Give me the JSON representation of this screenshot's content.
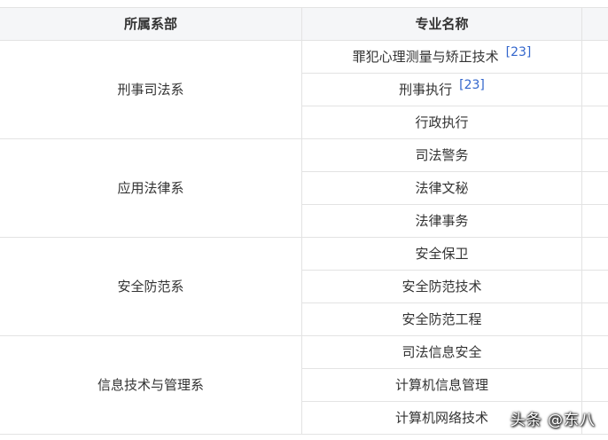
{
  "table": {
    "headers": {
      "department": "所属系部",
      "major": "专业名称",
      "extra": ""
    },
    "groups": [
      {
        "department": "刑事司法系",
        "majors": [
          {
            "name": "罪犯心理测量与矫正技术",
            "cite": "[23]"
          },
          {
            "name": "刑事执行",
            "cite": "[23]"
          },
          {
            "name": "行政执行",
            "cite": ""
          }
        ]
      },
      {
        "department": "应用法律系",
        "majors": [
          {
            "name": "司法警务",
            "cite": ""
          },
          {
            "name": "法律文秘",
            "cite": ""
          },
          {
            "name": "法律事务",
            "cite": ""
          }
        ]
      },
      {
        "department": "安全防范系",
        "majors": [
          {
            "name": "安全保卫",
            "cite": ""
          },
          {
            "name": "安全防范技术",
            "cite": ""
          },
          {
            "name": "安全防范工程",
            "cite": ""
          }
        ]
      },
      {
        "department": "信息技术与管理系",
        "majors": [
          {
            "name": "司法信息安全",
            "cite": ""
          },
          {
            "name": "计算机信息管理",
            "cite": ""
          },
          {
            "name": "计算机网络技术",
            "cite": ""
          }
        ]
      }
    ]
  },
  "watermark": "头条 @东八"
}
